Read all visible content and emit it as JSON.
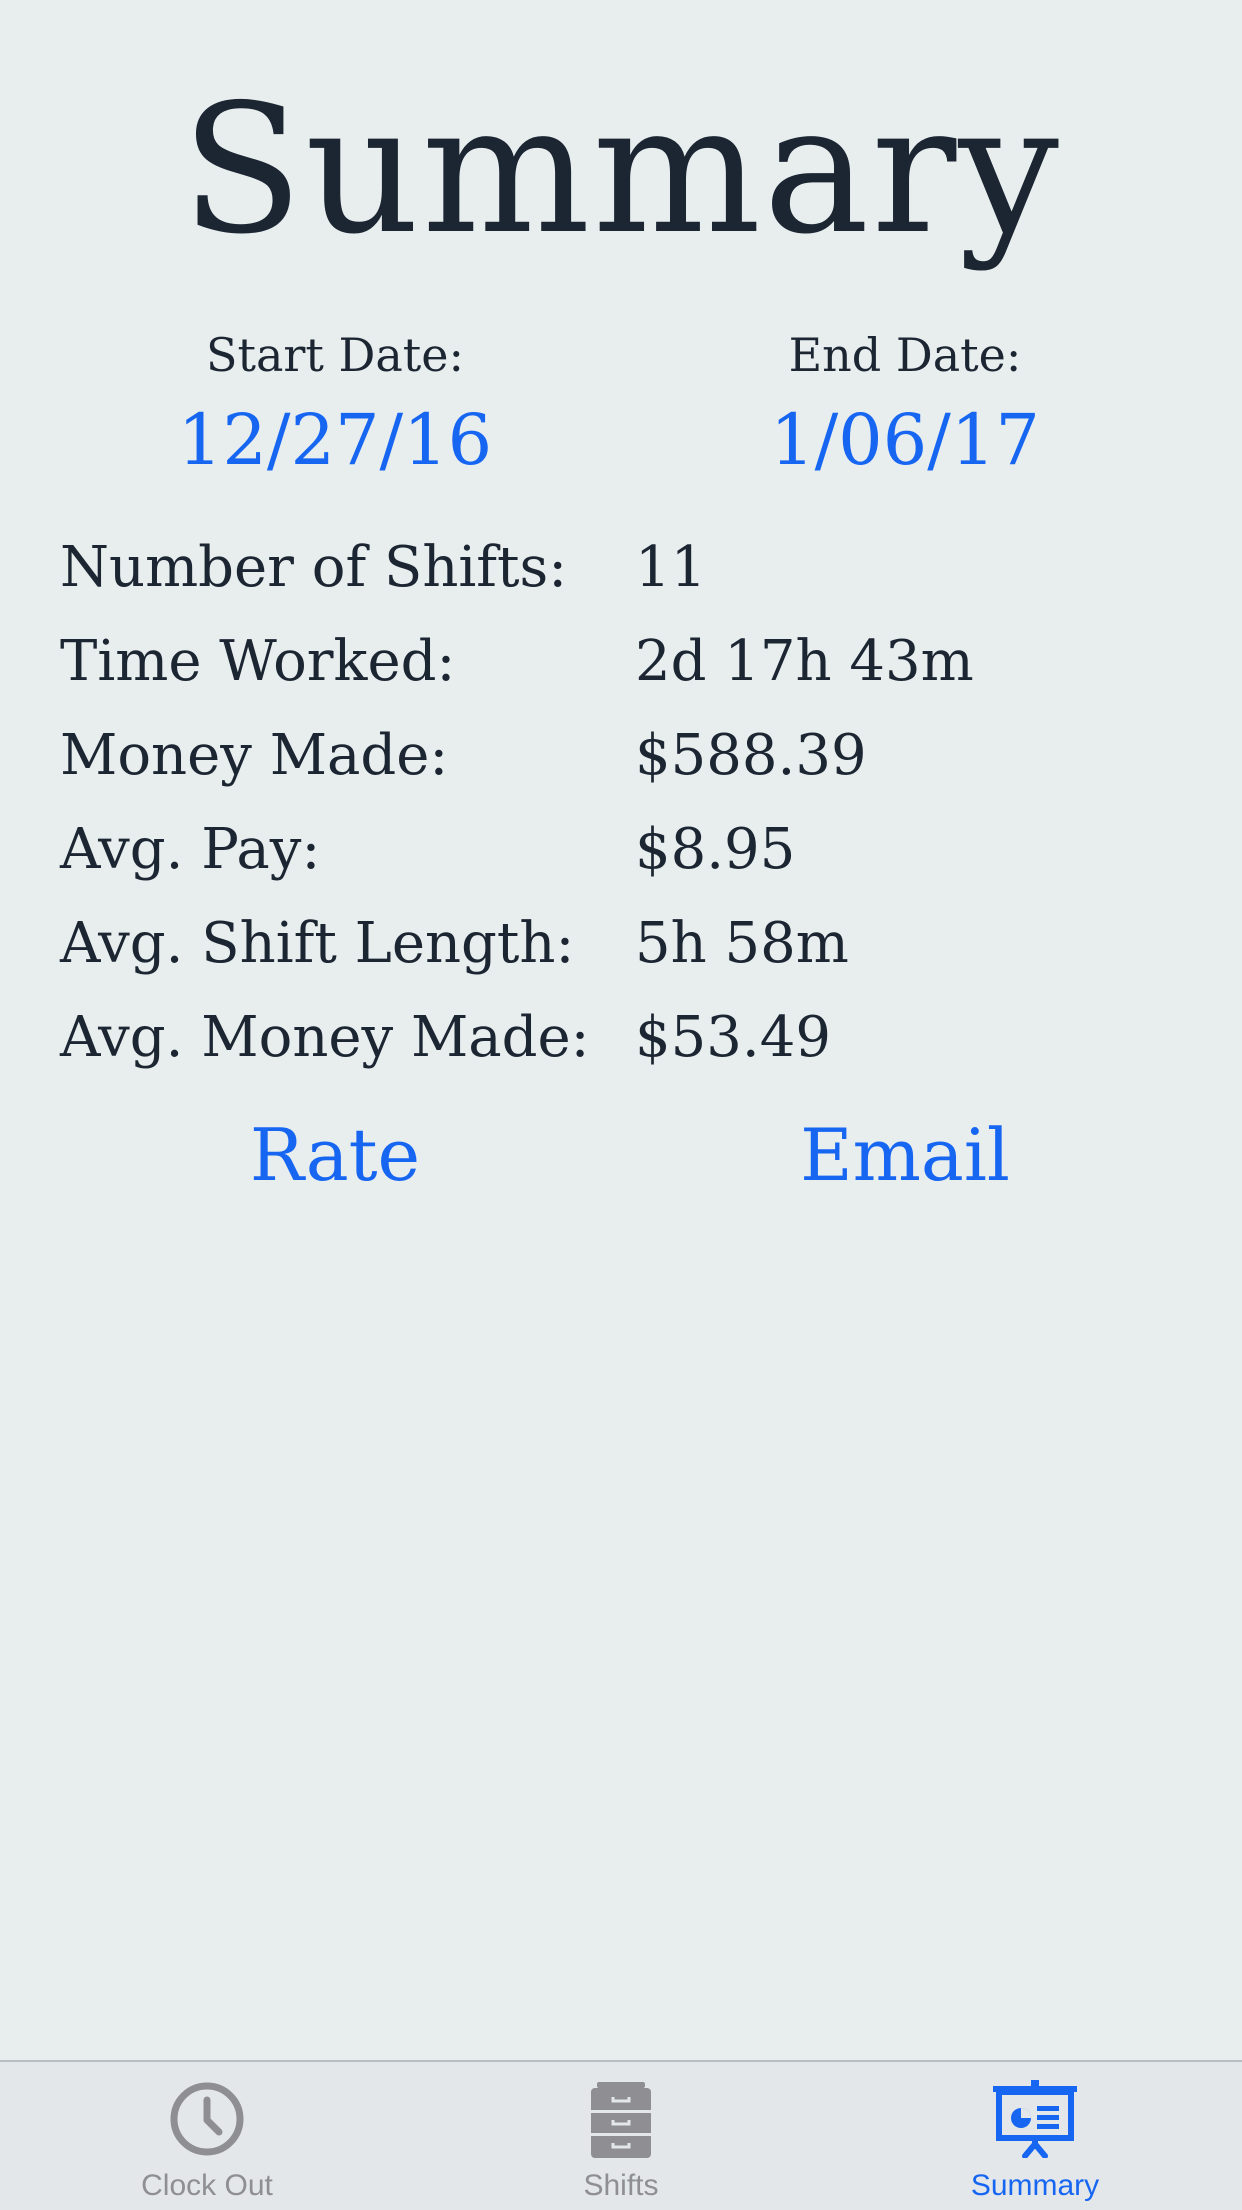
{
  "title": "Summary",
  "dates": {
    "start_label": "Start Date:",
    "start_value": "12/27/16",
    "end_label": "End Date:",
    "end_value": "1/06/17"
  },
  "stats": [
    {
      "label": "Number of Shifts:",
      "value": "11"
    },
    {
      "label": "Time Worked:",
      "value": "2d 17h 43m"
    },
    {
      "label": "Money Made:",
      "value": "$588.39"
    },
    {
      "label": "Avg. Pay:",
      "value": "$8.95"
    },
    {
      "label": "Avg. Shift Length:",
      "value": "5h 58m"
    },
    {
      "label": "Avg. Money Made:",
      "value": "$53.49"
    }
  ],
  "actions": {
    "rate": "Rate",
    "email": "Email"
  },
  "tabbar": {
    "tabs": [
      {
        "label": "Clock Out",
        "icon": "clock-icon",
        "active": false
      },
      {
        "label": "Shifts",
        "icon": "file-cabinet-icon",
        "active": false
      },
      {
        "label": "Summary",
        "icon": "presentation-board-icon",
        "active": true
      }
    ]
  },
  "colors": {
    "background": "#e8edee",
    "text": "#1c2633",
    "accent": "#1766f2",
    "tab_inactive": "#8e8e93"
  }
}
